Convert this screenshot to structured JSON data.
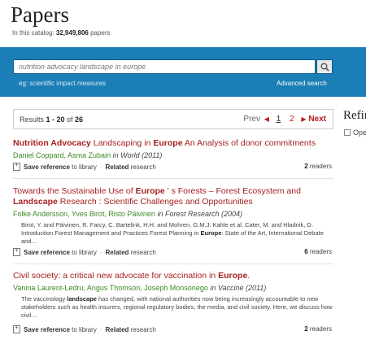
{
  "header": {
    "title": "Papers",
    "catalog_prefix": "In this catalog: ",
    "catalog_count": "32,949,806",
    "catalog_suffix": " papers"
  },
  "search": {
    "value": "nutrition advocacy landscape in europe",
    "hint": "eg: scientific impact measures",
    "advanced": "Advanced search"
  },
  "results": {
    "prefix": "Results ",
    "range": "1 - 20",
    "of": " of ",
    "total": "26",
    "prev": "Prev",
    "page1": "1",
    "page2": "2",
    "next": "Next"
  },
  "refine": {
    "title": "Refine",
    "open_access": "Open"
  },
  "actions": {
    "save": "Save reference",
    "to_library": " to library",
    "related": "Related",
    "research": " research",
    "readers_suffix": " readers"
  },
  "items": [
    {
      "title_a": "Nutrition Advocacy",
      "title_b": " Landscaping in ",
      "title_c": "Europe",
      "title_d": " An Analysis of donor commitments",
      "authors": "Daniel Coppard, Asma Zubairi",
      "venue_in": " in ",
      "venue": "World (2011)",
      "readers": "2"
    },
    {
      "title_a": "Towards the Sustainable Use of ",
      "title_b": "Europe",
      "title_c": " ' s Forests – Forest Ecosystem and ",
      "title_d": "Landscape",
      "title_e": " Research : Scientific Challenges and Opportunities",
      "authors": "Folke Andersson, Yves Birot, Risto Päivinen",
      "venue_in": " in ",
      "venue": "Forest Research (2004)",
      "snippet_a": "Birot, Y. and Päivinen, R. Farcy, C. Bartelink, H.H. and Mohren, G.M.J. Kahle et al. Cater, M. and Hladnik, D. Introduction Forest Management and Practices Forest Planning in ",
      "snippet_b": "Europe",
      "snippet_c": ": State of the Art, International Debate and…",
      "readers": "6"
    },
    {
      "title_a": "Civil society: a critical new advocate for vaccination in ",
      "title_b": "Europe",
      "title_c": ".",
      "authors": "Vanina Laurent-Ledru, Angus Thomson, Joseph Monsonego",
      "venue_in": " in ",
      "venue": "Vaccine (2011)",
      "snippet_a": "The vaccinology ",
      "snippet_b": "landscape",
      "snippet_c": " has changed, with national authorities now being increasingly accountable to new stakeholders such as health insurers, regional regulatory bodies, the media, and civil society. Here, we discuss how civil…",
      "readers": "2"
    }
  ]
}
